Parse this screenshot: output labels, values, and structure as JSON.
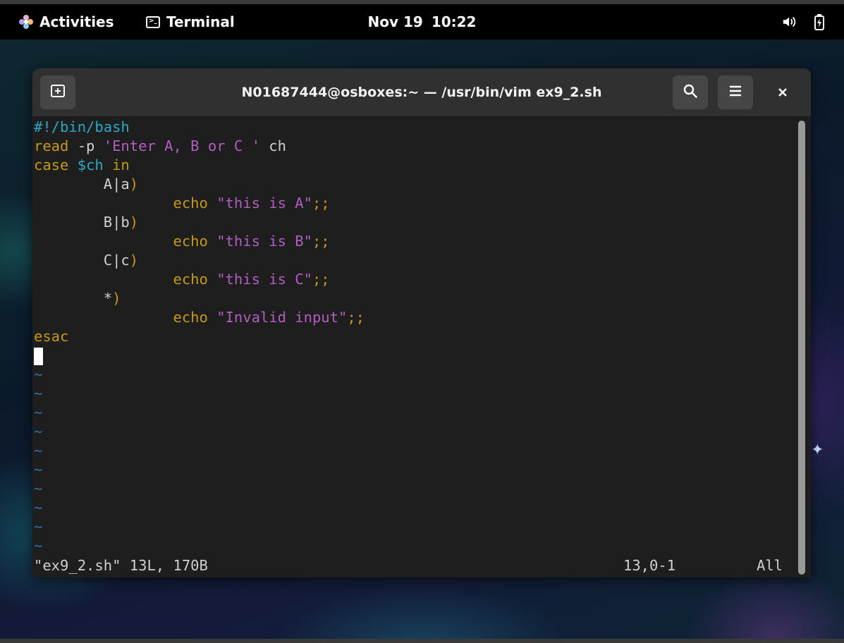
{
  "topbar": {
    "activities_label": "Activities",
    "app_label": "Terminal",
    "date": "Nov 19",
    "time": "10:22",
    "tray_icons": [
      "volume-icon",
      "battery-icon"
    ]
  },
  "window": {
    "title": "N01687444@osboxes:~ — /usr/bin/vim ex9_2.sh",
    "buttons": [
      "new-tab-icon",
      "search-icon",
      "hamburger-menu-icon",
      "close-icon"
    ]
  },
  "editor": {
    "lines": [
      [
        {
          "t": "#!/bin/bash",
          "c": "cyan"
        }
      ],
      [
        {
          "t": "read",
          "c": "yellow"
        },
        {
          "t": " -p ",
          "c": "white"
        },
        {
          "t": "'Enter A, B or C '",
          "c": "magenta"
        },
        {
          "t": " ch",
          "c": "white"
        }
      ],
      [
        {
          "t": "case",
          "c": "yellow"
        },
        {
          "t": " ",
          "c": "white"
        },
        {
          "t": "$ch",
          "c": "cyan"
        },
        {
          "t": " ",
          "c": "white"
        },
        {
          "t": "in",
          "c": "yellow"
        }
      ],
      [
        {
          "t": "        A|a",
          "c": "white"
        },
        {
          "t": ")",
          "c": "yellow"
        }
      ],
      [
        {
          "t": "                ",
          "c": "white"
        },
        {
          "t": "echo",
          "c": "yellow"
        },
        {
          "t": " ",
          "c": "white"
        },
        {
          "t": "\"this is A\"",
          "c": "magenta"
        },
        {
          "t": ";;",
          "c": "yellow"
        }
      ],
      [
        {
          "t": "        B|b",
          "c": "white"
        },
        {
          "t": ")",
          "c": "yellow"
        }
      ],
      [
        {
          "t": "                ",
          "c": "white"
        },
        {
          "t": "echo",
          "c": "yellow"
        },
        {
          "t": " ",
          "c": "white"
        },
        {
          "t": "\"this is B\"",
          "c": "magenta"
        },
        {
          "t": ";;",
          "c": "yellow"
        }
      ],
      [
        {
          "t": "        C|c",
          "c": "white"
        },
        {
          "t": ")",
          "c": "yellow"
        }
      ],
      [
        {
          "t": "                ",
          "c": "white"
        },
        {
          "t": "echo",
          "c": "yellow"
        },
        {
          "t": " ",
          "c": "white"
        },
        {
          "t": "\"this is C\"",
          "c": "magenta"
        },
        {
          "t": ";;",
          "c": "yellow"
        }
      ],
      [
        {
          "t": "        *",
          "c": "white"
        },
        {
          "t": ")",
          "c": "yellow"
        }
      ],
      [
        {
          "t": "                ",
          "c": "white"
        },
        {
          "t": "echo",
          "c": "yellow"
        },
        {
          "t": " ",
          "c": "white"
        },
        {
          "t": "\"Invalid input\"",
          "c": "magenta"
        },
        {
          "t": ";;",
          "c": "yellow"
        }
      ],
      [
        {
          "t": "esac",
          "c": "yellow"
        }
      ]
    ],
    "tilde_char": "~",
    "tilde_count": 10,
    "status_file": "\"ex9_2.sh\" 13L, 170B",
    "status_position": "13,0-1",
    "status_scroll": "All"
  },
  "colors": {
    "cyan": "#2aa8c6",
    "yellow": "#c49a18",
    "magenta": "#b35cc1",
    "text": "#d0d0d0",
    "tilde": "#2a6fb5",
    "terminal_bg": "#1e1e1e",
    "headerbar_bg": "#303030"
  }
}
